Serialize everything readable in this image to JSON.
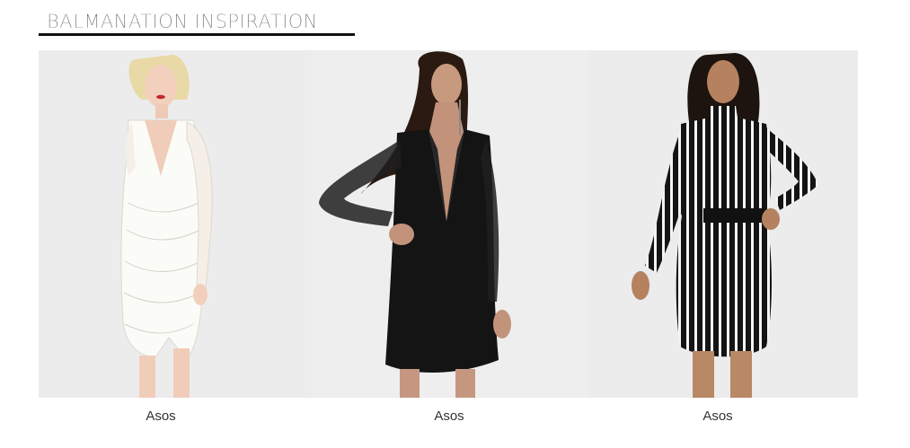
{
  "heading": "BALMANATION INSPIRATION",
  "products": [
    {
      "image": "white-lace-plunge-dress-photo",
      "caption": "Asos"
    },
    {
      "image": "black-tuxedo-blazer-dress-photo",
      "caption": "Asos"
    },
    {
      "image": "black-white-stripe-bodycon-dress-photo",
      "caption": "Asos"
    }
  ],
  "colors": {
    "accent_rule": "#111111",
    "panel_bg": "#ececec"
  }
}
